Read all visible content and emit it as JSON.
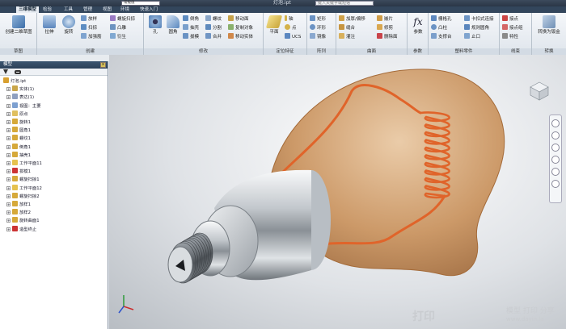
{
  "window": {
    "title": "灯泡.ipt",
    "project_combo": "常规值",
    "search_placeholder": "键入关键字或短语"
  },
  "tabs": [
    "三维模型",
    "检验",
    "工具",
    "管理",
    "视图",
    "环境",
    "快速入门"
  ],
  "ribbon": {
    "panels": [
      {
        "label": "草图",
        "big": [
          {
            "label": "创建二维草图"
          }
        ],
        "small": []
      },
      {
        "label": "创建",
        "big": [
          {
            "label": "拉伸"
          },
          {
            "label": "旋转"
          }
        ],
        "small": [
          "放样",
          "扫掠",
          "加强筋",
          "螺旋扫掠",
          "凸雕",
          "衍生"
        ]
      },
      {
        "label": "修改",
        "big": [
          {
            "label": "孔"
          },
          {
            "label": "圆角"
          }
        ],
        "small": [
          "倒角",
          "抽壳",
          "拔模",
          "螺纹",
          "分割",
          "合并",
          "移动面",
          "复制对象",
          "移动实体"
        ]
      },
      {
        "label": "定位特征",
        "big": [
          {
            "label": "平面"
          }
        ],
        "small": [
          "轴",
          "点",
          "UCS"
        ]
      },
      {
        "label": "阵列",
        "big": [],
        "small": [
          "矩形",
          "环形",
          "镜像"
        ]
      },
      {
        "label": "曲面",
        "big": [],
        "small": [
          "加厚/偏移",
          "缝合",
          "灌注",
          "嵌片",
          "修剪",
          "删除面"
        ]
      },
      {
        "label": "参数",
        "big": [
          {
            "label": "参数"
          }
        ],
        "small": []
      },
      {
        "label": "塑料零件",
        "big": [],
        "small": [
          "栅格孔",
          "凸柱",
          "支撑台",
          "卡扣式连接",
          "规则圆角",
          "止口"
        ]
      },
      {
        "label": "线束",
        "big": [],
        "small": [
          "接点",
          "接点组",
          "特性"
        ]
      },
      {
        "label": "转换",
        "big": [
          {
            "label": "转换为钣金"
          }
        ],
        "small": []
      }
    ]
  },
  "browser": {
    "title": "模型",
    "close_label": "x",
    "items": [
      {
        "label": "灯泡.ipt",
        "level": 0,
        "icon_color": "#d8a030"
      },
      {
        "label": "实体(1)",
        "level": 1,
        "icon_color": "#c9a64a"
      },
      {
        "label": "表达(1)",
        "level": 1,
        "icon_color": "#8fa0c0"
      },
      {
        "label": "视图：主要",
        "level": 1,
        "icon_color": "#7da0d0"
      },
      {
        "label": "原点",
        "level": 1,
        "icon_color": "#e0c060"
      },
      {
        "label": "旋转1",
        "level": 1,
        "icon_color": "#d6a93a"
      },
      {
        "label": "圆角1",
        "level": 1,
        "icon_color": "#d6a93a"
      },
      {
        "label": "螺纹1",
        "level": 1,
        "icon_color": "#d6a93a"
      },
      {
        "label": "倒角1",
        "level": 1,
        "icon_color": "#d6a93a"
      },
      {
        "label": "抽壳1",
        "level": 1,
        "icon_color": "#d6a93a"
      },
      {
        "label": "工作平面11",
        "level": 1,
        "icon_color": "#e6c24e"
      },
      {
        "label": "拔模1",
        "level": 1,
        "icon_color": "#cc3333"
      },
      {
        "label": "螺旋扫掠1",
        "level": 1,
        "icon_color": "#d6a93a"
      },
      {
        "label": "工作平面12",
        "level": 1,
        "icon_color": "#e6c24e"
      },
      {
        "label": "螺旋扫掠2",
        "level": 1,
        "icon_color": "#d6a93a"
      },
      {
        "label": "放样1",
        "level": 1,
        "icon_color": "#d6a93a"
      },
      {
        "label": "放样2",
        "level": 1,
        "icon_color": "#d6a93a"
      },
      {
        "label": "旋转曲面1",
        "level": 1,
        "icon_color": "#d6a93a"
      },
      {
        "label": "造型终止",
        "level": 1,
        "icon_color": "#cc3333"
      }
    ]
  },
  "watermark": {
    "main": "打印",
    "side1": "模型 打印 分享",
    "side2": "www.dayin.la"
  },
  "colors": {
    "accent": "#33465c",
    "bulb": "#c88a4e",
    "filament": "#e0642a"
  }
}
